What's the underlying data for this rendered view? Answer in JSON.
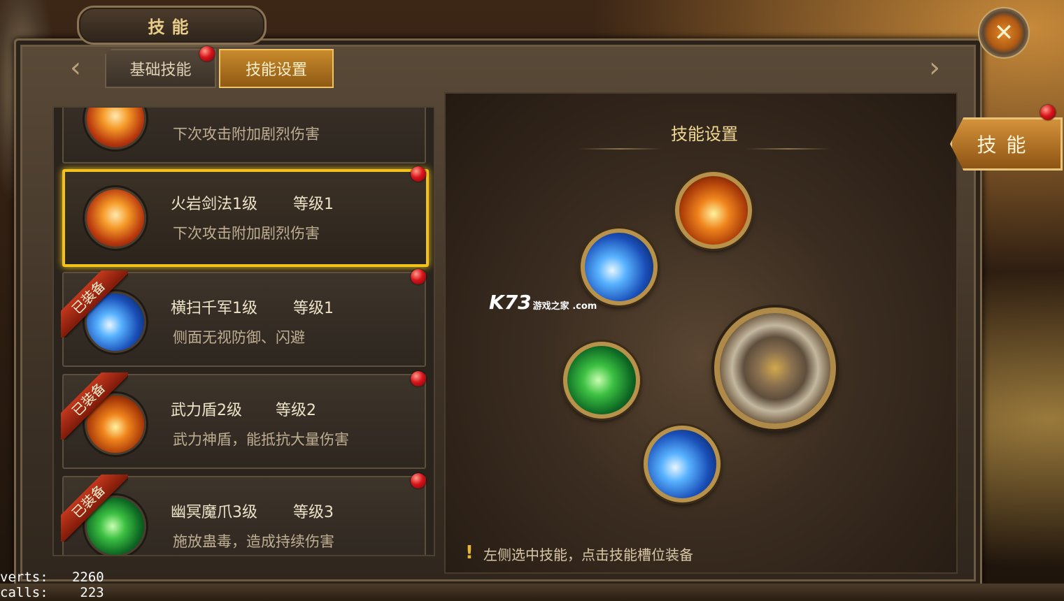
{
  "window": {
    "title": "技能"
  },
  "tabs": [
    {
      "label": "基础技能",
      "active": false,
      "badge": true
    },
    {
      "label": "技能设置",
      "active": true,
      "badge": false
    }
  ],
  "skills": [
    {
      "name": "",
      "level": "",
      "desc": "下次攻击附加剧烈伤害",
      "icon": "fire-sword-icon",
      "equipped": false,
      "selected": false
    },
    {
      "name": "火岩剑法1级",
      "level": "等级1",
      "desc": "下次攻击附加剧烈伤害",
      "icon": "fire-sword-icon",
      "equipped": false,
      "selected": true
    },
    {
      "name": "横扫千军1级",
      "level": "等级1",
      "desc": "侧面无视防御、闪避",
      "icon": "blue-slash-icon",
      "equipped": true,
      "selected": false
    },
    {
      "name": "武力盾2级",
      "level": "等级2",
      "desc": "武力神盾，能抵抗大量伤害",
      "icon": "force-shield-icon",
      "equipped": true,
      "selected": false
    },
    {
      "name": "幽冥魔爪3级",
      "level": "等级3",
      "desc": "施放蛊毒，造成持续伤害",
      "icon": "green-claw-icon",
      "equipped": true,
      "selected": false
    }
  ],
  "equipped_label": "已装备",
  "setup": {
    "title": "技能设置",
    "hint": "左侧选中技能，点击技能槽位装备",
    "slots": [
      "force-shield-icon",
      "blue-slash-icon",
      "green-claw-icon",
      "blue-strike-icon"
    ],
    "main_icon": "axe-attack-icon"
  },
  "side_tab": {
    "label": "技能"
  },
  "watermark": {
    "brand": "K73",
    "sub": "游戏之家 .com"
  },
  "debug": {
    "verts": "verts:   2260",
    "calls": "calls:    223"
  },
  "colors": {
    "selected_border": "#f2c21c",
    "badge": "#d8141a",
    "tab_active": "#c98a2c"
  }
}
